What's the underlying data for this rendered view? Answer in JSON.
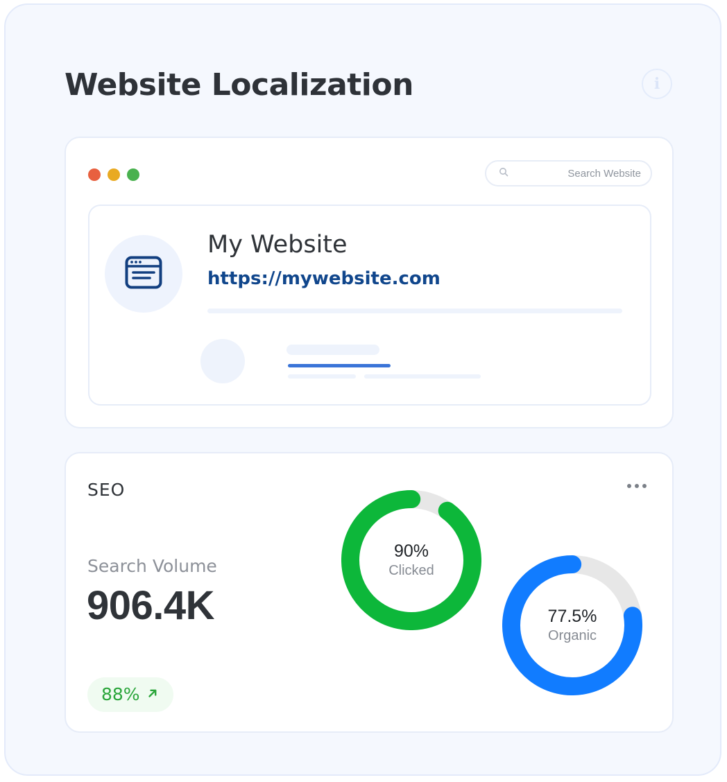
{
  "page": {
    "title": "Website Localization",
    "info_icon": "info-icon"
  },
  "browser": {
    "window_dots": [
      {
        "name": "close",
        "color": "#e8603f"
      },
      {
        "name": "minimize",
        "color": "#e9aa22"
      },
      {
        "name": "maximize",
        "color": "#49b14e"
      }
    ],
    "search": {
      "placeholder": "Search Website",
      "value": "",
      "icon": "search-icon"
    },
    "site": {
      "icon": "browser-window-icon",
      "name": "My Website",
      "url": "https://mywebsite.com"
    },
    "accent_color": "#3a74d8"
  },
  "seo": {
    "title": "SEO",
    "menu_icon": "more-horizontal-icon",
    "metric": {
      "label": "Search Volume",
      "value": "906.4K"
    },
    "change": {
      "value": "88%",
      "direction": "up",
      "icon": "arrow-up-right-icon",
      "color": "#2aa53a"
    }
  },
  "chart_data": [
    {
      "type": "pie",
      "style": "donut",
      "value_percent": 90,
      "label": "Clicked",
      "display_value": "90%",
      "color": "#0db73a",
      "track_color": "#e7e7e7"
    },
    {
      "type": "pie",
      "style": "donut",
      "value_percent": 77.5,
      "label": "Organic",
      "display_value": "77.5%",
      "color": "#117cff",
      "track_color": "#e7e7e7"
    }
  ]
}
